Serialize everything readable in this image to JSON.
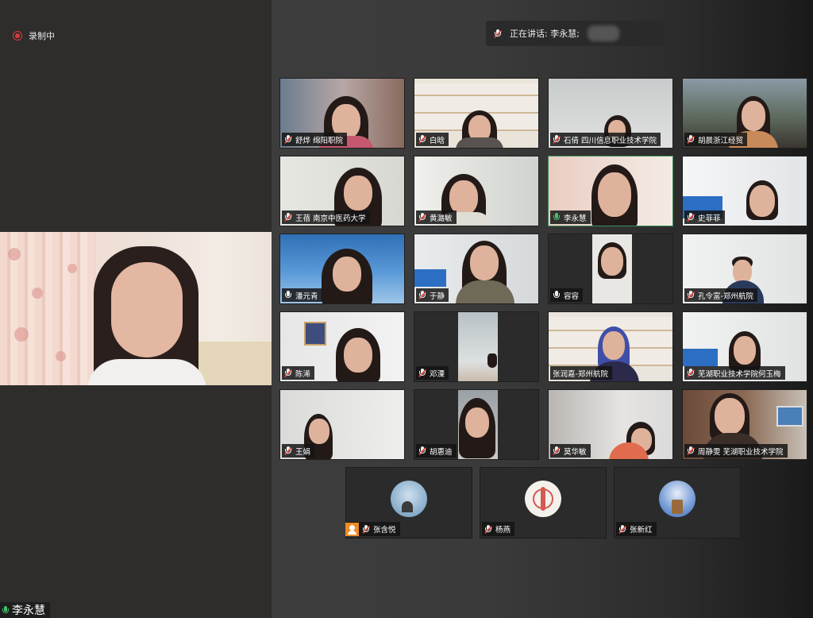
{
  "recording": {
    "label": "录制中"
  },
  "speaking": {
    "label": "正在讲话: 李永慧;"
  },
  "main_speaker": {
    "name": "李永慧"
  },
  "participants": [
    {
      "name": "舒烨 绵阳职院",
      "mic": "muted"
    },
    {
      "name": "白晗",
      "mic": "muted"
    },
    {
      "name": "石倩 四川信息职业技术学院",
      "mic": "muted"
    },
    {
      "name": "胡晨浙江经贸",
      "mic": "muted"
    },
    {
      "name": "王蓓 南京中医药大学",
      "mic": "muted"
    },
    {
      "name": "黄潞敏",
      "mic": "muted"
    },
    {
      "name": "李永慧",
      "mic": "live"
    },
    {
      "name": "史菲菲",
      "mic": "muted"
    },
    {
      "name": "潘元青",
      "mic": "on"
    },
    {
      "name": "于静",
      "mic": "muted"
    },
    {
      "name": "容容",
      "mic": "on"
    },
    {
      "name": "孔令富-郑州航院",
      "mic": "muted"
    },
    {
      "name": "陈浠",
      "mic": "muted"
    },
    {
      "name": "邓溧",
      "mic": "muted"
    },
    {
      "name": "张润嘉-郑州航院",
      "mic": "muted"
    },
    {
      "name": "芜湖职业技术学院何玉梅",
      "mic": "muted"
    },
    {
      "name": "王娟",
      "mic": "muted"
    },
    {
      "name": "胡惠迪",
      "mic": "muted"
    },
    {
      "name": "莫华敏",
      "mic": "muted"
    },
    {
      "name": "周静雯 芜湖职业技术学院",
      "mic": "muted"
    }
  ],
  "avatar_participants": [
    {
      "name": "张含悦",
      "mic": "muted"
    },
    {
      "name": "杨燕",
      "mic": "muted"
    },
    {
      "name": "张新红",
      "mic": "muted"
    }
  ],
  "icons": {
    "recording": "record-dot-icon",
    "mic_muted": "mic-muted-icon",
    "mic_on": "mic-icon",
    "mic_live": "mic-active-icon",
    "profile": "user-avatar-icon"
  },
  "colors": {
    "record": "#d63a3a",
    "muted_slash": "#e0453d",
    "live_mic": "#45c06b",
    "active_border": "#3b8f5a",
    "profile_badge": "#f08a24"
  }
}
